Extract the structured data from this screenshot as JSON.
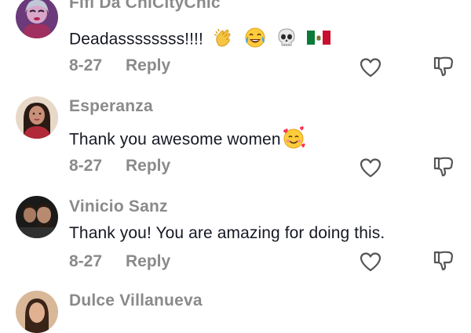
{
  "comments": [
    {
      "username": "Fifi Da ChiCityChic",
      "text": "Deadassssssss!!!!",
      "emojis": [
        "clapping-hands",
        "tears-of-joy-face",
        "skull",
        "mexico-flag"
      ],
      "date": "8-27",
      "reply_label": "Reply"
    },
    {
      "username": "Esperanza",
      "text": "Thank you awesome women",
      "emojis": [
        "smiling-face-with-hearts"
      ],
      "date": "8-27",
      "reply_label": "Reply"
    },
    {
      "username": "Vinicio Sanz",
      "text": "Thank you! You are amazing for doing this.",
      "emojis": [],
      "date": "8-27",
      "reply_label": "Reply"
    },
    {
      "username": "Dulce Villanueva"
    }
  ],
  "colors": {
    "secondary_text": "#8a8a8a",
    "primary_text": "#161823",
    "background": "#ffffff"
  }
}
